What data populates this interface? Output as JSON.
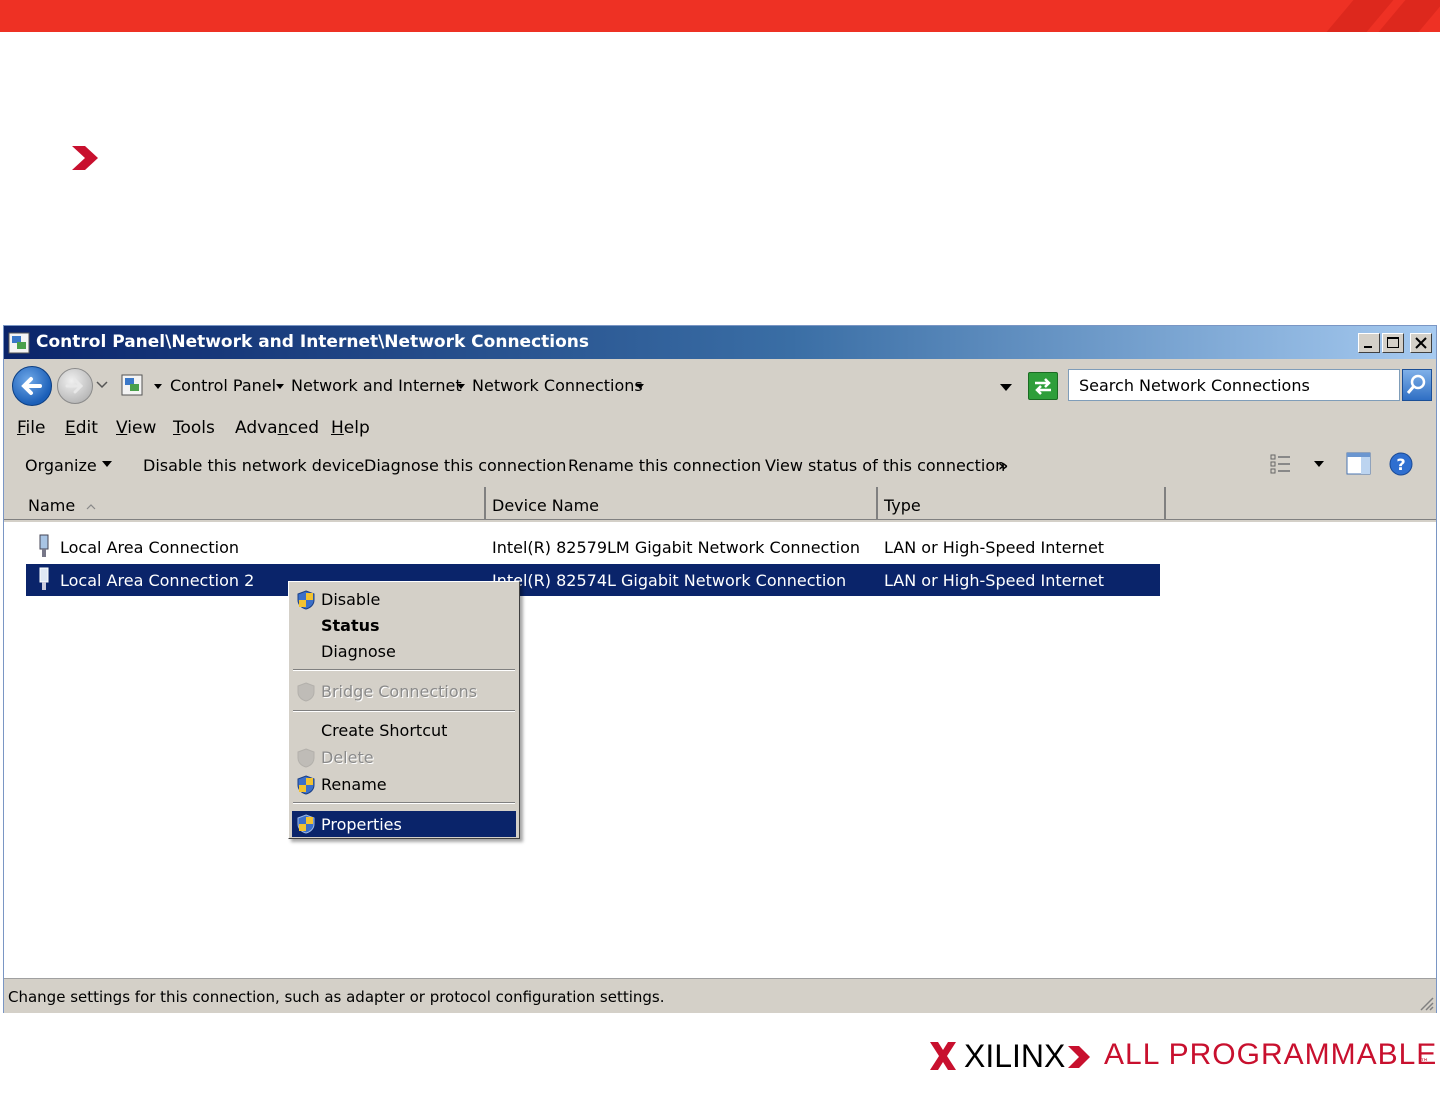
{
  "colors": {
    "accent_red": "#ee3124",
    "selection": "#0a246a",
    "chrome": "#d4d0c8"
  },
  "window": {
    "title": "Control Panel\\Network and Internet\\Network Connections",
    "icon": "network-connections-icon"
  },
  "address": {
    "crumbs": [
      "Control Panel",
      "Network and Internet",
      "Network Connections"
    ]
  },
  "search": {
    "placeholder": "Search Network Connections"
  },
  "menubar": {
    "file": {
      "key": "F",
      "rest": "ile"
    },
    "edit": {
      "key": "E",
      "rest": "dit"
    },
    "view": {
      "key": "V",
      "rest": "iew"
    },
    "tools": {
      "key": "T",
      "rest": "ools"
    },
    "advanced": {
      "pre": "Adva",
      "key": "n",
      "rest": "ced"
    },
    "help": {
      "key": "H",
      "rest": "elp"
    }
  },
  "commandbar": {
    "organize": "Organize",
    "disable": "Disable this network device",
    "diagnose": "Diagnose this connection",
    "rename": "Rename this connection",
    "status": "View status of this connection",
    "more": "»"
  },
  "columns": {
    "name": "Name",
    "device": "Device Name",
    "type": "Type"
  },
  "rows": [
    {
      "name": "Local Area Connection",
      "device": "Intel(R) 82579LM Gigabit Network Connection",
      "type": "LAN or High-Speed Internet"
    },
    {
      "name": "Local Area Connection 2",
      "device": "Intel(R) 82574L Gigabit Network Connection",
      "type": "LAN or High-Speed Internet"
    }
  ],
  "context_menu": {
    "disable": "Disable",
    "status": "Status",
    "diagnose": "Diagnose",
    "bridge": "Bridge Connections",
    "shortcut": "Create Shortcut",
    "delete": "Delete",
    "rename": "Rename",
    "properties": "Properties"
  },
  "statusbar": {
    "text": "Change settings for this connection, such as adapter or protocol configuration settings."
  },
  "footer": {
    "brand": "XILINX",
    "tagline": "ALL PROGRAMMABLE",
    "tm": "™"
  }
}
